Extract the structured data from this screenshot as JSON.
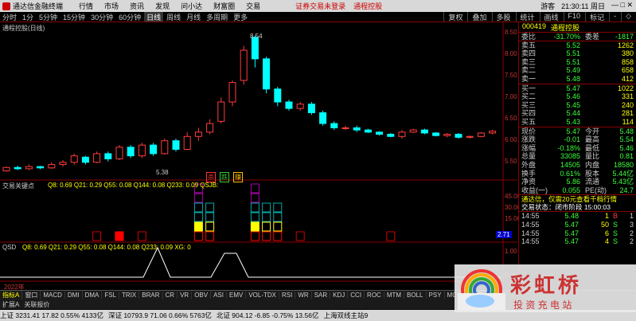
{
  "titlebar": {
    "app_name": "通达信金融终端",
    "menus": [
      "行情",
      "市场",
      "资讯",
      "发现",
      "问小达",
      "财富圈",
      "交易"
    ],
    "ad1": "证券交易未登录",
    "ad2": "通程控股",
    "right_label": "游客",
    "clock": "21:30:11 周日"
  },
  "toolbar": {
    "periods": [
      "分时",
      "1分",
      "5分钟",
      "15分钟",
      "30分钟",
      "60分钟",
      "日线",
      "周线",
      "月线",
      "多周期",
      "更多"
    ],
    "active_period": "日线",
    "tools": [
      "复权",
      "叠加",
      "多股",
      "统计",
      "画线",
      "F10",
      "标记",
      "-",
      "◇"
    ]
  },
  "chart": {
    "main_title": "通程控股(日线)",
    "high_label": "8.54",
    "low_label": "5.38",
    "y_ticks": [
      "8.50",
      "8.00",
      "7.50",
      "7.00",
      "6.50",
      "6.00",
      "5.50"
    ],
    "markers": [
      "杀",
      "跌",
      "赚"
    ],
    "ind_title": "交易关键点",
    "ind_values": "Q8: 0.69  Q21: 0.29  Q55: 0.08  Q144: 0.08  Q233: 0.09  QSJB:",
    "ind_ticks": [
      "45.00",
      "30.00",
      "15.00"
    ],
    "price_badge": "2.71",
    "qsd_title": "QSD",
    "qsd_values": "Q8: 0.69  Q21: 0.29  Q55: 0.08  Q144: 0.08  Q233: 0.09  XG: 0",
    "qsd_ticks": [
      "1.00",
      "0.00"
    ],
    "year_label": "2022年",
    "chart_data": {
      "type": "candlestick",
      "candles": [
        [
          5.4,
          5.48,
          5.38,
          5.5
        ],
        [
          5.48,
          5.45,
          5.42,
          5.52
        ],
        [
          5.45,
          5.5,
          5.42,
          5.55
        ],
        [
          5.5,
          5.47,
          5.44,
          5.52
        ],
        [
          5.47,
          5.55,
          5.45,
          5.6
        ],
        [
          5.55,
          5.6,
          5.5,
          5.65
        ],
        [
          5.6,
          5.75,
          5.55,
          5.8
        ],
        [
          5.72,
          5.6,
          5.55,
          5.75
        ],
        [
          5.6,
          5.8,
          5.58,
          5.85
        ],
        [
          5.8,
          5.68,
          5.62,
          5.85
        ],
        [
          5.68,
          5.95,
          5.65,
          6.0
        ],
        [
          5.95,
          5.75,
          5.7,
          6.0
        ],
        [
          5.75,
          6.0,
          5.7,
          6.05
        ],
        [
          6.0,
          5.8,
          5.75,
          6.05
        ],
        [
          5.8,
          6.1,
          5.78,
          6.15
        ],
        [
          6.1,
          5.9,
          5.85,
          6.15
        ],
        [
          5.9,
          6.2,
          5.88,
          6.3
        ],
        [
          6.2,
          6.3,
          6.1,
          6.4
        ],
        [
          6.3,
          6.5,
          6.25,
          6.6
        ],
        [
          6.55,
          7.0,
          6.5,
          7.1
        ],
        [
          7.0,
          7.45,
          6.9,
          7.5
        ],
        [
          7.5,
          8.2,
          7.4,
          8.3
        ],
        [
          8.5,
          8.0,
          7.8,
          8.54
        ],
        [
          8.0,
          7.3,
          7.2,
          8.05
        ],
        [
          7.3,
          7.0,
          6.9,
          7.35
        ],
        [
          7.0,
          6.85,
          6.8,
          7.05
        ],
        [
          6.85,
          6.95,
          6.8,
          7.0
        ],
        [
          6.95,
          6.75,
          6.7,
          7.0
        ],
        [
          6.75,
          6.5,
          6.45,
          6.8
        ],
        [
          6.5,
          6.4,
          6.35,
          6.55
        ],
        [
          6.4,
          6.4,
          6.35,
          6.45
        ],
        [
          6.4,
          6.35,
          6.3,
          6.45
        ],
        [
          6.35,
          6.3,
          6.28,
          6.38
        ],
        [
          6.3,
          6.25,
          6.22,
          6.32
        ],
        [
          6.25,
          6.2,
          6.18,
          6.28
        ],
        [
          6.2,
          6.3,
          6.15,
          6.35
        ],
        [
          6.3,
          6.35,
          6.28,
          6.38
        ],
        [
          6.35,
          6.28,
          6.25,
          6.38
        ],
        [
          6.28,
          6.22,
          6.2,
          6.3
        ],
        [
          6.22,
          6.25,
          6.18,
          6.28
        ],
        [
          6.25,
          6.18,
          6.15,
          6.28
        ],
        [
          6.18,
          6.2,
          6.15,
          6.22
        ],
        [
          6.2,
          6.28,
          6.18,
          6.3
        ],
        [
          6.28,
          6.32,
          6.25,
          6.35
        ]
      ],
      "qsjb_cols": [
        {
          "i": 8,
          "h": 1,
          "c": "#c00"
        },
        {
          "i": 10,
          "h": 1,
          "c": "#f00"
        },
        {
          "i": 12,
          "h": 1,
          "c": "#c00"
        },
        {
          "i": 17,
          "h": 6,
          "c": "#a0a"
        },
        {
          "i": 18,
          "h": 4,
          "c": "#fb0"
        },
        {
          "i": 22,
          "h": 6,
          "c": "#a0a"
        },
        {
          "i": 23,
          "h": 4,
          "c": "#fb0"
        },
        {
          "i": 24,
          "h": 4,
          "c": "#fb0"
        },
        {
          "i": 26,
          "h": 1,
          "c": "#c00"
        },
        {
          "i": 34,
          "h": 1,
          "c": "#c00"
        }
      ]
    }
  },
  "quote": {
    "code": "000419",
    "name": "通程控股",
    "wb_label": "委比",
    "wb_value": "-31.70%",
    "wc_label": "委差",
    "wc_value": "-1817",
    "asks": [
      {
        "l": "卖五",
        "p": "5.52",
        "v": "1262"
      },
      {
        "l": "卖四",
        "p": "5.51",
        "v": "380"
      },
      {
        "l": "卖三",
        "p": "5.51",
        "v": "858"
      },
      {
        "l": "卖二",
        "p": "5.49",
        "v": "658"
      },
      {
        "l": "卖一",
        "p": "5.48",
        "v": "412"
      }
    ],
    "bids": [
      {
        "l": "买一",
        "p": "5.47",
        "v": "1022"
      },
      {
        "l": "买二",
        "p": "5.46",
        "v": "331"
      },
      {
        "l": "买三",
        "p": "5.45",
        "v": "240"
      },
      {
        "l": "买四",
        "p": "5.44",
        "v": "281"
      },
      {
        "l": "买五",
        "p": "5.43",
        "v": "114"
      }
    ],
    "stats": [
      {
        "l1": "现价",
        "v1": "5.47",
        "l2": "今开",
        "v2": "5.48"
      },
      {
        "l1": "涨跌",
        "v1": "-0.01",
        "l2": "最高",
        "v2": "5.54"
      },
      {
        "l1": "涨幅",
        "v1": "-0.18%",
        "l2": "最低",
        "v2": "5.46"
      },
      {
        "l1": "总量",
        "v1": "33085",
        "l2": "量比",
        "v2": "0.81"
      },
      {
        "l1": "外盘",
        "v1": "14505",
        "l2": "内盘",
        "v2": "18580"
      },
      {
        "l1": "换手",
        "v1": "0.61%",
        "l2": "股本",
        "v2": "5.44亿"
      },
      {
        "l1": "净资",
        "v1": "5.86",
        "l2": "流通",
        "v2": "5.43亿"
      },
      {
        "l1": "收益(一)",
        "v1": "0.055",
        "l2": "PE(动)",
        "v2": "24.7"
      }
    ],
    "promo": "通达信，仅需20元查看千档行情",
    "trade_status": "交易状态：闭市阶段 15:00:03",
    "ticks": [
      {
        "t": "14:55",
        "p": "5.48",
        "v": "1",
        "f": "B",
        "n": "1"
      },
      {
        "t": "14:55",
        "p": "5.47",
        "v": "50",
        "f": "S",
        "n": "3"
      },
      {
        "t": "14:55",
        "p": "5.47",
        "v": "6",
        "f": "S",
        "n": "2"
      },
      {
        "t": "14:55",
        "p": "5.47",
        "v": "4",
        "f": "S",
        "n": "2"
      }
    ]
  },
  "ticker": {
    "items": [
      "指标A",
      "窗口",
      "MACD",
      "DMI",
      "DMA",
      "FSL",
      "TRIX",
      "BRAR",
      "CR",
      "VR",
      "OBV",
      "ASI",
      "EMV",
      "VOL-TDX",
      "RSI",
      "WR",
      "SAR",
      "KDJ",
      "CCI",
      "ROC",
      "MTM",
      "BOLL",
      "PSY",
      "MCST",
      "更多",
      "设置"
    ],
    "row2": [
      "扩展A",
      "关联报价"
    ]
  },
  "status": {
    "items": [
      "上证 3231.41  17.82  0.55%  4133亿",
      "深证 10793.9  71.06  0.66%  5763亿",
      "北证 904.12  -6.85  -0.75%  13.56亿",
      "上海双线主站9"
    ]
  },
  "watermark": {
    "brand": "彩虹桥",
    "sub": "投 资 充 电 站"
  }
}
